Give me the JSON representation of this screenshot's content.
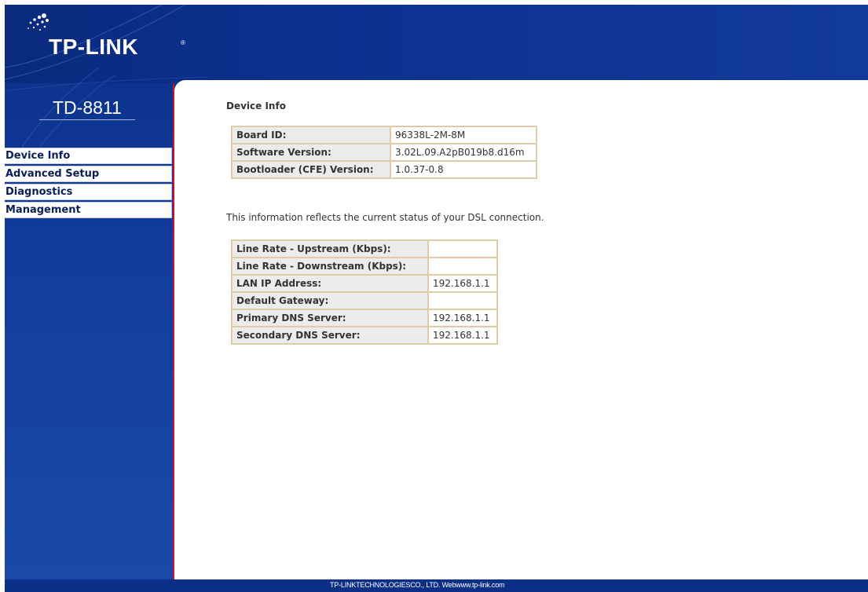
{
  "brand": {
    "logo": "TP-LINK",
    "registered": "®",
    "model": "TD-8811"
  },
  "menu": {
    "items": [
      {
        "label": "Device Info"
      },
      {
        "label": "Advanced Setup"
      },
      {
        "label": "Diagnostics"
      },
      {
        "label": "Management"
      }
    ]
  },
  "main": {
    "title": "Device Info",
    "device_table": [
      {
        "label": "Board ID:",
        "value": "96338L-2M-8M"
      },
      {
        "label": "Software Version:",
        "value": "3.02L.09.A2pB019b8.d16m"
      },
      {
        "label": "Bootloader (CFE) Version:",
        "value": "1.0.37-0.8"
      }
    ],
    "status_text": "This information reflects the current status of your DSL connection.",
    "connection_table": [
      {
        "label": "Line Rate - Upstream (Kbps):",
        "value": ""
      },
      {
        "label": "Line Rate - Downstream (Kbps):",
        "value": ""
      },
      {
        "label": "LAN IP Address:",
        "value": "192.168.1.1"
      },
      {
        "label": "Default Gateway:",
        "value": ""
      },
      {
        "label": "Primary DNS Server:",
        "value": "192.168.1.1"
      },
      {
        "label": "Secondary DNS Server:",
        "value": "192.168.1.1"
      }
    ]
  },
  "footer": {
    "text": "TP-LINKTECHNOLOGIESCO., LTD. Webwww.tp-link.com"
  },
  "colors": {
    "sidebar_blue": "#123d9d",
    "header_blue": "#0c3190",
    "accent_red": "#c01a2e",
    "label_bg": "#ececec",
    "table_border": "#e0cba8"
  }
}
